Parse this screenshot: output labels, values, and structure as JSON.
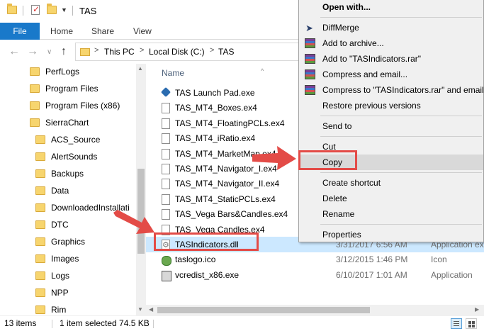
{
  "window": {
    "title": "TAS"
  },
  "ribbon": {
    "tabs": [
      "File",
      "Home",
      "Share",
      "View"
    ]
  },
  "address": {
    "crumbs": [
      "This PC",
      "Local Disk (C:)",
      "TAS"
    ],
    "separator": ">"
  },
  "nav_pane": {
    "items": [
      {
        "label": "PerfLogs",
        "indent": 0
      },
      {
        "label": "Program Files",
        "indent": 0
      },
      {
        "label": "Program Files (x86)",
        "indent": 0
      },
      {
        "label": "SierraChart",
        "indent": 0
      },
      {
        "label": "ACS_Source",
        "indent": 1
      },
      {
        "label": "AlertSounds",
        "indent": 1
      },
      {
        "label": "Backups",
        "indent": 1
      },
      {
        "label": "Data",
        "indent": 1
      },
      {
        "label": "DownloadedInstallati",
        "indent": 1
      },
      {
        "label": "DTC",
        "indent": 1
      },
      {
        "label": "Graphics",
        "indent": 1
      },
      {
        "label": "Images",
        "indent": 1
      },
      {
        "label": "Logs",
        "indent": 1
      },
      {
        "label": "NPP",
        "indent": 1
      },
      {
        "label": "Rim",
        "indent": 1
      }
    ]
  },
  "file_list": {
    "column_name": "Name",
    "files": [
      {
        "name": "TAS Launch Pad.exe",
        "date": "",
        "type": "",
        "icon": "exe"
      },
      {
        "name": "TAS_MT4_Boxes.ex4",
        "date": "",
        "type": "",
        "icon": "doc"
      },
      {
        "name": "TAS_MT4_FloatingPCLs.ex4",
        "date": "",
        "type": "",
        "icon": "doc"
      },
      {
        "name": "TAS_MT4_iRatio.ex4",
        "date": "",
        "type": "",
        "icon": "doc"
      },
      {
        "name": "TAS_MT4_MarketMap.ex4",
        "date": "",
        "type": "",
        "icon": "doc"
      },
      {
        "name": "TAS_MT4_Navigator_I.ex4",
        "date": "",
        "type": "",
        "icon": "doc"
      },
      {
        "name": "TAS_MT4_Navigator_II.ex4",
        "date": "",
        "type": "",
        "icon": "doc"
      },
      {
        "name": "TAS_MT4_StaticPCLs.ex4",
        "date": "",
        "type": "",
        "icon": "doc"
      },
      {
        "name": "TAS_Vega Bars&Candles.ex4",
        "date": "",
        "type": "",
        "icon": "doc"
      },
      {
        "name": "TAS_Vega Candles.ex4",
        "date": "",
        "type": "",
        "icon": "doc"
      },
      {
        "name": "TASIndicators.dll",
        "date": "3/31/2017 6:56 AM",
        "type": "Application ext",
        "icon": "dll",
        "selected": true
      },
      {
        "name": "taslogo.ico",
        "date": "3/12/2015 1:46 PM",
        "type": "Icon",
        "icon": "ico"
      },
      {
        "name": "vcredist_x86.exe",
        "date": "6/10/2017 1:01 AM",
        "type": "Application",
        "icon": "vc"
      }
    ]
  },
  "status": {
    "count": "13 items",
    "selection": "1 item selected 74.5 KB"
  },
  "context_menu": {
    "items": [
      {
        "label": "Open with...",
        "bold": true,
        "icon": ""
      },
      {
        "sep": true
      },
      {
        "label": "DiffMerge",
        "icon": "diff"
      },
      {
        "label": "Add to archive...",
        "icon": "rar"
      },
      {
        "label": "Add to \"TASIndicators.rar\"",
        "icon": "rar"
      },
      {
        "label": "Compress and email...",
        "icon": "rar"
      },
      {
        "label": "Compress to \"TASIndicators.rar\" and email",
        "icon": "rar"
      },
      {
        "label": "Restore previous versions",
        "icon": ""
      },
      {
        "sep": true
      },
      {
        "label": "Send to",
        "icon": ""
      },
      {
        "sep": true
      },
      {
        "label": "Cut",
        "icon": ""
      },
      {
        "label": "Copy",
        "icon": "",
        "hover": true
      },
      {
        "sep": true
      },
      {
        "label": "Create shortcut",
        "icon": ""
      },
      {
        "label": "Delete",
        "icon": ""
      },
      {
        "label": "Rename",
        "icon": ""
      },
      {
        "sep": true
      },
      {
        "label": "Properties",
        "icon": ""
      }
    ]
  },
  "colors": {
    "accent": "#1979ca",
    "selection": "#cce8ff",
    "annotation": "#e34b47"
  }
}
